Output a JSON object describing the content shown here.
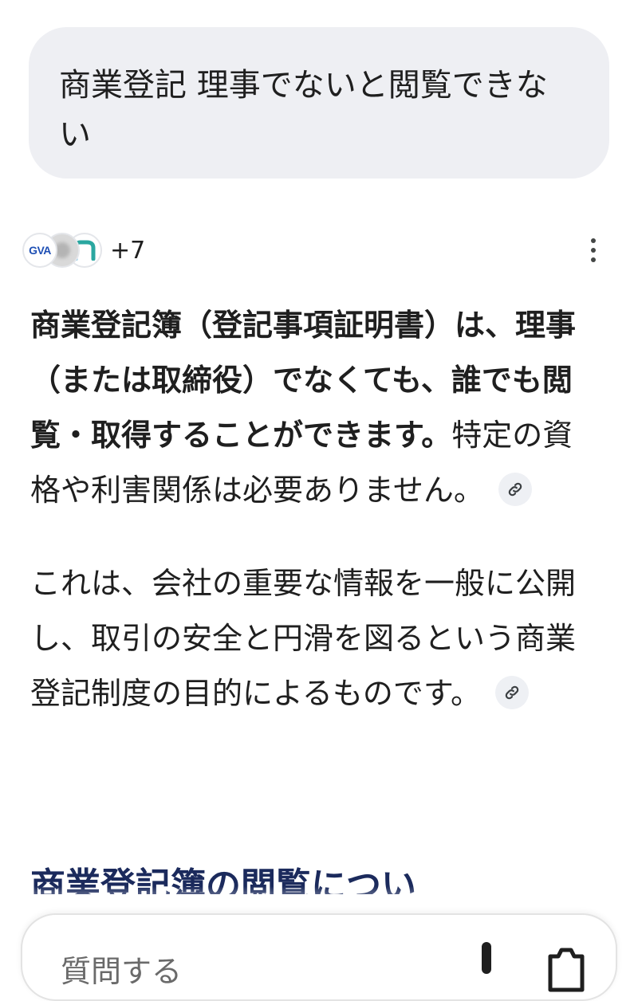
{
  "query": {
    "text": "商業登記 理事でないと閲覧できない"
  },
  "sources": {
    "avatars": [
      "GVA",
      "",
      "n"
    ],
    "more_count": "+7"
  },
  "answer": {
    "p1_bold": "商業登記簿（登記事項証明書）は、理事（または取締役）でなくても、誰でも閲覧・取得することができます。",
    "p1_rest": "特定の資格や利害関係は必要ありません。",
    "p2": "これは、会社の重要な情報を一般に公開し、取引の安全と円滑を図るという商業登記制度の目的によるものです。",
    "next_heading": "商業登記簿の閲覧につい"
  },
  "input": {
    "placeholder": "質問する"
  },
  "colors": {
    "bubble_bg": "#eeeff3",
    "heading": "#1b2a5c",
    "citation_bg": "#eef0f4"
  }
}
